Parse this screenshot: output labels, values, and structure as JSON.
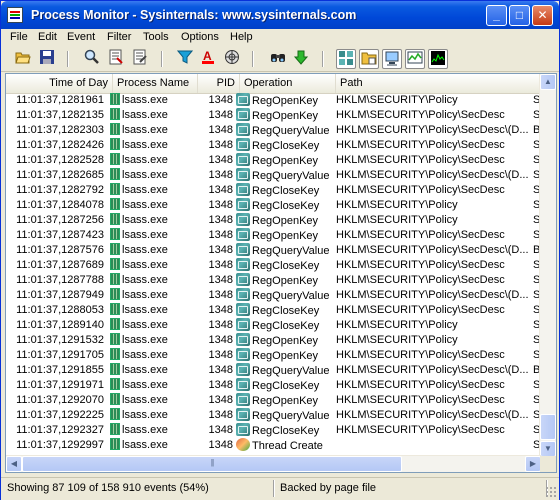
{
  "window": {
    "title": "Process Monitor - Sysinternals: www.sysinternals.com",
    "minimize_label": "_",
    "maximize_label": "□",
    "close_label": "✕"
  },
  "menu": [
    "File",
    "Edit",
    "Event",
    "Filter",
    "Tools",
    "Options",
    "Help"
  ],
  "toolbar": {
    "icons": [
      "open-icon",
      "save-icon",
      "magnifier-icon",
      "autoscroll-icon",
      "clear-icon",
      "filter-icon",
      "highlight-icon",
      "network-icon",
      "find-icon",
      "jump-icon",
      "registry-icon",
      "filesystem-icon",
      "network-activity-icon",
      "process-activity-icon",
      "profiling-icon"
    ]
  },
  "columns": {
    "time": "Time of Day",
    "process": "Process Name",
    "pid": "PID",
    "operation": "Operation",
    "path": "Path"
  },
  "rows": [
    {
      "time": "11:01:37,1281961",
      "process": "lsass.exe",
      "pid": "1348",
      "op": "RegOpenKey",
      "path": "HKLM\\SECURITY\\Policy",
      "res": "S"
    },
    {
      "time": "11:01:37,1282135",
      "process": "lsass.exe",
      "pid": "1348",
      "op": "RegOpenKey",
      "path": "HKLM\\SECURITY\\Policy\\SecDesc",
      "res": "S"
    },
    {
      "time": "11:01:37,1282303",
      "process": "lsass.exe",
      "pid": "1348",
      "op": "RegQueryValue",
      "path": "HKLM\\SECURITY\\Policy\\SecDesc\\(D...",
      "res": "B"
    },
    {
      "time": "11:01:37,1282426",
      "process": "lsass.exe",
      "pid": "1348",
      "op": "RegCloseKey",
      "path": "HKLM\\SECURITY\\Policy\\SecDesc",
      "res": "S"
    },
    {
      "time": "11:01:37,1282528",
      "process": "lsass.exe",
      "pid": "1348",
      "op": "RegOpenKey",
      "path": "HKLM\\SECURITY\\Policy\\SecDesc",
      "res": "S"
    },
    {
      "time": "11:01:37,1282685",
      "process": "lsass.exe",
      "pid": "1348",
      "op": "RegQueryValue",
      "path": "HKLM\\SECURITY\\Policy\\SecDesc\\(D...",
      "res": "S"
    },
    {
      "time": "11:01:37,1282792",
      "process": "lsass.exe",
      "pid": "1348",
      "op": "RegCloseKey",
      "path": "HKLM\\SECURITY\\Policy\\SecDesc",
      "res": "S"
    },
    {
      "time": "11:01:37,1284078",
      "process": "lsass.exe",
      "pid": "1348",
      "op": "RegCloseKey",
      "path": "HKLM\\SECURITY\\Policy",
      "res": "S"
    },
    {
      "time": "11:01:37,1287256",
      "process": "lsass.exe",
      "pid": "1348",
      "op": "RegOpenKey",
      "path": "HKLM\\SECURITY\\Policy",
      "res": "S"
    },
    {
      "time": "11:01:37,1287423",
      "process": "lsass.exe",
      "pid": "1348",
      "op": "RegOpenKey",
      "path": "HKLM\\SECURITY\\Policy\\SecDesc",
      "res": "S"
    },
    {
      "time": "11:01:37,1287576",
      "process": "lsass.exe",
      "pid": "1348",
      "op": "RegQueryValue",
      "path": "HKLM\\SECURITY\\Policy\\SecDesc\\(D...",
      "res": "B"
    },
    {
      "time": "11:01:37,1287689",
      "process": "lsass.exe",
      "pid": "1348",
      "op": "RegCloseKey",
      "path": "HKLM\\SECURITY\\Policy\\SecDesc",
      "res": "S"
    },
    {
      "time": "11:01:37,1287788",
      "process": "lsass.exe",
      "pid": "1348",
      "op": "RegOpenKey",
      "path": "HKLM\\SECURITY\\Policy\\SecDesc",
      "res": "S"
    },
    {
      "time": "11:01:37,1287949",
      "process": "lsass.exe",
      "pid": "1348",
      "op": "RegQueryValue",
      "path": "HKLM\\SECURITY\\Policy\\SecDesc\\(D...",
      "res": "S"
    },
    {
      "time": "11:01:37,1288053",
      "process": "lsass.exe",
      "pid": "1348",
      "op": "RegCloseKey",
      "path": "HKLM\\SECURITY\\Policy\\SecDesc",
      "res": "S"
    },
    {
      "time": "11:01:37,1289140",
      "process": "lsass.exe",
      "pid": "1348",
      "op": "RegCloseKey",
      "path": "HKLM\\SECURITY\\Policy",
      "res": "S"
    },
    {
      "time": "11:01:37,1291532",
      "process": "lsass.exe",
      "pid": "1348",
      "op": "RegOpenKey",
      "path": "HKLM\\SECURITY\\Policy",
      "res": "S"
    },
    {
      "time": "11:01:37,1291705",
      "process": "lsass.exe",
      "pid": "1348",
      "op": "RegOpenKey",
      "path": "HKLM\\SECURITY\\Policy\\SecDesc",
      "res": "S"
    },
    {
      "time": "11:01:37,1291855",
      "process": "lsass.exe",
      "pid": "1348",
      "op": "RegQueryValue",
      "path": "HKLM\\SECURITY\\Policy\\SecDesc\\(D...",
      "res": "B"
    },
    {
      "time": "11:01:37,1291971",
      "process": "lsass.exe",
      "pid": "1348",
      "op": "RegCloseKey",
      "path": "HKLM\\SECURITY\\Policy\\SecDesc",
      "res": "S"
    },
    {
      "time": "11:01:37,1292070",
      "process": "lsass.exe",
      "pid": "1348",
      "op": "RegOpenKey",
      "path": "HKLM\\SECURITY\\Policy\\SecDesc",
      "res": "S"
    },
    {
      "time": "11:01:37,1292225",
      "process": "lsass.exe",
      "pid": "1348",
      "op": "RegQueryValue",
      "path": "HKLM\\SECURITY\\Policy\\SecDesc\\(D...",
      "res": "S"
    },
    {
      "time": "11:01:37,1292327",
      "process": "lsass.exe",
      "pid": "1348",
      "op": "RegCloseKey",
      "path": "HKLM\\SECURITY\\Policy\\SecDesc",
      "res": "S"
    },
    {
      "time": "11:01:37,1292997",
      "process": "lsass.exe",
      "pid": "1348",
      "op": "Thread Create",
      "path": "",
      "res": "S"
    }
  ],
  "scrollbar": {
    "up": "▲",
    "down": "▼",
    "left": "◀",
    "right": "▶",
    "grip": "|||"
  },
  "status": {
    "events": "Showing 87 109 of 158 910 events (54%)",
    "backing": "Backed by page file"
  }
}
